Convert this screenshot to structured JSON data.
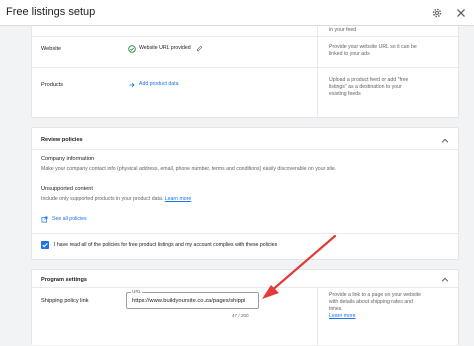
{
  "header": {
    "title": "Free listings setup"
  },
  "section_top": {
    "partial_right_text": "in your feed",
    "website": {
      "label": "Website",
      "status": "Website URL provided",
      "help": [
        "Provide your website URL so it can be",
        "linked to your ads"
      ]
    },
    "products": {
      "label": "Products",
      "action": "Add product data",
      "help": [
        "Upload a product feed or add \"free",
        "listings\" as a destination to your",
        "existing feeds"
      ]
    }
  },
  "review_policies": {
    "title": "Review policies",
    "company_info": {
      "heading": "Company information",
      "desc": "Make your company contact info (physical address, email, phone number, terms and conditions) easily discoverable on your site."
    },
    "unsupported": {
      "heading": "Unsupported content",
      "desc": "Include only supported products in your product data.",
      "learn_more": "Learn more"
    },
    "see_all": "See all policies",
    "agreement": "I have read all of the policies for free product listings and my account complies with these policies"
  },
  "program_settings": {
    "title": "Program settings",
    "shipping_label": "Shipping policy link",
    "url_field_label": "URL",
    "url_value": "https://www.buildyoursite.co.za/pages/shippi",
    "char_count": "47 / 200",
    "help": [
      "Provide a link to a page on your website",
      "with details about shipping rates and",
      "times."
    ],
    "learn_more": "Learn more"
  },
  "colors": {
    "accent": "#1a73e8",
    "arrow": "#e53935",
    "success": "#188038"
  }
}
